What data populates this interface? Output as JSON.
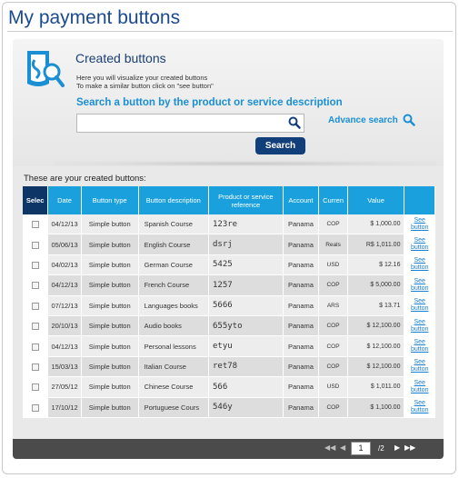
{
  "page": {
    "title": "My payment buttons"
  },
  "intro": {
    "heading": "Created buttons",
    "help_line1": "Here you will visualize your created buttons",
    "help_line2": "To make a similar button click on \"see button\""
  },
  "search": {
    "heading": "Search a button by the product or service description",
    "value": "",
    "placeholder": "",
    "button_label": "Search",
    "advance_label": "Advance search"
  },
  "list": {
    "caption": "These are your created buttons:",
    "columns": [
      "Selec",
      "Date",
      "Button type",
      "Button description",
      "Product or service reference",
      "Account",
      "Curren",
      "Value",
      ""
    ],
    "rows": [
      {
        "date": "04/12/13",
        "type": "Simple button",
        "desc": "Spanish Course",
        "ref": "123re",
        "account": "Panama",
        "currency": "COP",
        "value": "$ 1,000.00",
        "see": "See button"
      },
      {
        "date": "05/06/13",
        "type": "Simple button",
        "desc": "English Course",
        "ref": "dsrj",
        "account": "Panama",
        "currency": "Reals",
        "value": "R$ 1,011.00",
        "see": "See button"
      },
      {
        "date": "04/02/13",
        "type": "Simple button",
        "desc": "German Course",
        "ref": "5425",
        "account": "Panama",
        "currency": "USD",
        "value": "$ 12.16",
        "see": "See button"
      },
      {
        "date": "04/12/13",
        "type": "Simple button",
        "desc": "French Course",
        "ref": "1257",
        "account": "Panama",
        "currency": "COP",
        "value": "$ 5,000.00",
        "see": "See button"
      },
      {
        "date": "07/12/13",
        "type": "Simple button",
        "desc": "Languages books",
        "ref": "5666",
        "account": "Panama",
        "currency": "ARS",
        "value": "$ 13.71",
        "see": "See button"
      },
      {
        "date": "20/10/13",
        "type": "Simple button",
        "desc": "Audio books",
        "ref": "655yto",
        "account": "Panama",
        "currency": "COP",
        "value": "$ 12,100.00",
        "see": "See button"
      },
      {
        "date": "04/12/13",
        "type": "Simple button",
        "desc": "Personal lessons",
        "ref": "etyu",
        "account": "Panama",
        "currency": "COP",
        "value": "$ 12,100.00",
        "see": "See button"
      },
      {
        "date": "15/03/13",
        "type": "Simple button",
        "desc": "Italian Course",
        "ref": "ret78",
        "account": "Panama",
        "currency": "COP",
        "value": "$ 12,100.00",
        "see": "See button"
      },
      {
        "date": "27/05/12",
        "type": "Simple button",
        "desc": "Chinese Course",
        "ref": "566",
        "account": "Panama",
        "currency": "USD",
        "value": "$ 1,011.00",
        "see": "See button"
      },
      {
        "date": "17/10/12",
        "type": "Simple button",
        "desc": "Portuguese Cours",
        "ref": "546y",
        "account": "Panama",
        "currency": "COP",
        "value": "$ 1,100.00",
        "see": "See button"
      }
    ]
  },
  "pagination": {
    "current": "1",
    "total": "/2"
  },
  "colors": {
    "header_blue": "#1aa0dd",
    "header_navy": "#0d3565",
    "title_blue": "#1a4a8f",
    "link_blue": "#1a8fd4",
    "footer": "#4b4b4b"
  }
}
